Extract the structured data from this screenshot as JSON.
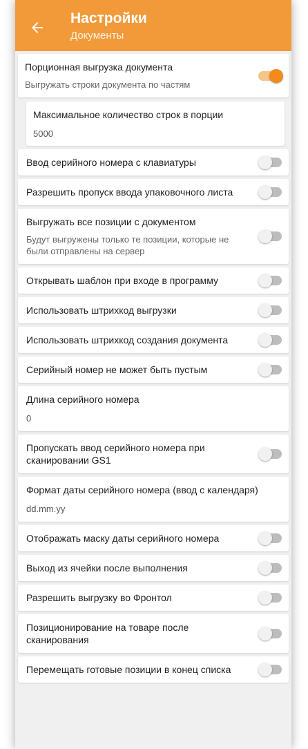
{
  "header": {
    "title": "Настройки",
    "subtitle": "Документы",
    "back_icon": "arrow-left-icon"
  },
  "colors": {
    "accent": "#f29a3a",
    "toggle_on_thumb": "#f28a1c",
    "toggle_off_thumb": "#f1f1f1"
  },
  "settings": [
    {
      "label": "Порционная выгрузка документа",
      "subtitle": "Выгружать строки документа по частям",
      "toggle": true
    },
    {
      "label": "Максимальное количество строк в порции",
      "value": "5000"
    },
    {
      "label": "Ввод серийного номера с клавиатуры",
      "toggle": false
    },
    {
      "label": "Разрешить пропуск ввода упаковочного листа",
      "toggle": false
    },
    {
      "label": "Выгружать все позиции с документом",
      "subtitle": "Будут выгружены только те позиции, которые не были отправлены на сервер",
      "toggle": false
    },
    {
      "label": "Открывать шаблон при входе в программу",
      "toggle": false
    },
    {
      "label": "Использовать штрихкод выгрузки",
      "toggle": false
    },
    {
      "label": "Использовать штрихкод создания документа",
      "toggle": false
    },
    {
      "label": "Серийный номер не может быть пустым",
      "toggle": false
    },
    {
      "label": "Длина серийного номера",
      "value": "0"
    },
    {
      "label": "Пропускать ввод серийного номера при сканировании GS1",
      "toggle": false
    },
    {
      "label": "Формат даты серийного номера (ввод с календаря)",
      "value": "dd.mm.yy"
    },
    {
      "label": "Отображать маску даты серийного номера",
      "toggle": false
    },
    {
      "label": "Выход из ячейки после выполнения",
      "toggle": false
    },
    {
      "label": "Разрешить выгрузку во Фронтол",
      "toggle": false
    },
    {
      "label": "Позиционирование на товаре после сканирования",
      "toggle": false
    },
    {
      "label": "Перемещать готовые позиции в конец списка",
      "toggle": false
    }
  ]
}
